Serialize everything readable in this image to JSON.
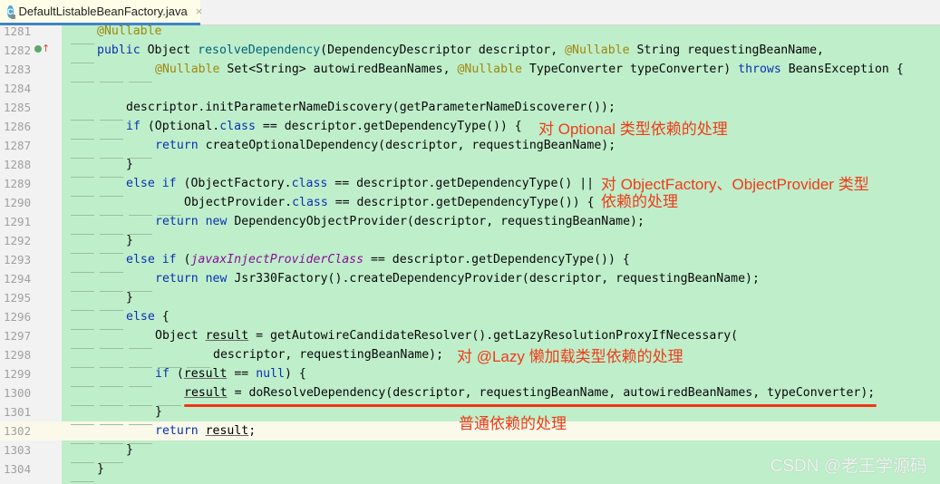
{
  "tab": {
    "icon": "java-class-icon",
    "icon_letter": "C",
    "filename": "DefaultListableBeanFactory.java",
    "close": "×"
  },
  "lines": [
    {
      "num": "1281",
      "indent": "——",
      "html": [
        [
          "ann",
          "@Nullable"
        ]
      ]
    },
    {
      "num": "1282",
      "indent": "——",
      "html": [
        [
          "kw",
          "public"
        ],
        [
          "code",
          " Object "
        ],
        [
          "fn",
          "resolveDependency"
        ],
        [
          "code",
          "(DependencyDescriptor descriptor, "
        ],
        [
          "ann",
          "@Nullable"
        ],
        [
          "code",
          " String requestingBeanName,"
        ]
      ]
    },
    {
      "num": "1283",
      "indent": "—— —— ——",
      "html": [
        [
          "ann",
          "@Nullable"
        ],
        [
          "code",
          " Set<String> autowiredBeanNames, "
        ],
        [
          "ann",
          "@Nullable"
        ],
        [
          "code",
          " TypeConverter typeConverter) "
        ],
        [
          "kw",
          "throws"
        ],
        [
          "code",
          " BeansException {"
        ]
      ]
    },
    {
      "num": "1284",
      "indent": "",
      "html": []
    },
    {
      "num": "1285",
      "indent": "—— ——",
      "html": [
        [
          "code",
          "descriptor.initParameterNameDiscovery(getParameterNameDiscoverer());"
        ]
      ]
    },
    {
      "num": "1286",
      "indent": "—— ——",
      "html": [
        [
          "kw",
          "if"
        ],
        [
          "code",
          " (Optional."
        ],
        [
          "kw",
          "class"
        ],
        [
          "code",
          " == descriptor.getDependencyType()) {"
        ]
      ]
    },
    {
      "num": "1287",
      "indent": "—— —— ——",
      "html": [
        [
          "kw",
          "return"
        ],
        [
          "code",
          " createOptionalDependency(descriptor, requestingBeanName);"
        ]
      ]
    },
    {
      "num": "1288",
      "indent": "—— ——",
      "html": [
        [
          "code",
          "}"
        ]
      ]
    },
    {
      "num": "1289",
      "indent": "—— ——",
      "html": [
        [
          "kw",
          "else if"
        ],
        [
          "code",
          " (ObjectFactory."
        ],
        [
          "kw",
          "class"
        ],
        [
          "code",
          " == descriptor.getDependencyType() ||"
        ]
      ]
    },
    {
      "num": "1290",
      "indent": "—— —— —— ——",
      "html": [
        [
          "code",
          "ObjectProvider."
        ],
        [
          "kw",
          "class"
        ],
        [
          "code",
          " == descriptor.getDependencyType()) {"
        ]
      ]
    },
    {
      "num": "1291",
      "indent": "—— —— ——",
      "html": [
        [
          "kw",
          "return new"
        ],
        [
          "code",
          " DependencyObjectProvider(descriptor, requestingBeanName);"
        ]
      ]
    },
    {
      "num": "1292",
      "indent": "—— ——",
      "html": [
        [
          "code",
          "}"
        ]
      ]
    },
    {
      "num": "1293",
      "indent": "—— ——",
      "html": [
        [
          "kw",
          "else if"
        ],
        [
          "code",
          " ("
        ],
        [
          "it",
          "javaxInjectProviderClass"
        ],
        [
          "code",
          " == descriptor.getDependencyType()) {"
        ]
      ]
    },
    {
      "num": "1294",
      "indent": "—— —— ——",
      "html": [
        [
          "kw",
          "return new"
        ],
        [
          "code",
          " Jsr330Factory().createDependencyProvider(descriptor, requestingBeanName);"
        ]
      ]
    },
    {
      "num": "1295",
      "indent": "—— ——",
      "html": [
        [
          "code",
          "}"
        ]
      ]
    },
    {
      "num": "1296",
      "indent": "—— ——",
      "html": [
        [
          "kw",
          "else"
        ],
        [
          "code",
          " {"
        ]
      ]
    },
    {
      "num": "1297",
      "indent": "—— —— ——",
      "html": [
        [
          "code",
          "Object "
        ],
        [
          "ul",
          "result"
        ],
        [
          "code",
          " = getAutowireCandidateResolver().getLazyResolutionProxyIfNecessary("
        ]
      ]
    },
    {
      "num": "1298",
      "indent": "—— —— —— —— ——",
      "html": [
        [
          "code",
          "descriptor, requestingBeanName);"
        ]
      ]
    },
    {
      "num": "1299",
      "indent": "—— —— ——",
      "html": [
        [
          "kw",
          "if"
        ],
        [
          "code",
          " ("
        ],
        [
          "ul",
          "result"
        ],
        [
          "code",
          " == "
        ],
        [
          "kw",
          "null"
        ],
        [
          "code",
          ") {"
        ]
      ]
    },
    {
      "num": "1300",
      "indent": "—— —— —— ——",
      "html": [
        [
          "ul",
          "result"
        ],
        [
          "code",
          " = doResolveDependency(descriptor, requestingBeanName, autowiredBeanNames, typeConverter);"
        ]
      ]
    },
    {
      "num": "1301",
      "indent": "—— —— ——",
      "html": [
        [
          "code",
          "}"
        ]
      ]
    },
    {
      "num": "1302",
      "indent": "—— —— ——",
      "html": [
        [
          "kw",
          "return"
        ],
        [
          "code",
          " "
        ],
        [
          "ul",
          "result"
        ],
        [
          "code",
          ";"
        ]
      ]
    },
    {
      "num": "1303",
      "indent": "—— ——",
      "html": [
        [
          "code",
          "}"
        ]
      ]
    },
    {
      "num": "1304",
      "indent": "——",
      "html": [
        [
          "code",
          "}"
        ]
      ]
    }
  ],
  "annotations": {
    "optional": "对 Optional 类型依赖的处理",
    "object_factory_1": "对 ObjectFactory、ObjectProvider 类型",
    "object_factory_2": "依赖的处理",
    "lazy": "对 @Lazy 懒加载类型依赖的处理",
    "normal": "普通依赖的处理"
  },
  "current_line": "1302",
  "colors": {
    "diff_bg": "#bfeecb",
    "annotation": "#f03b16",
    "keyword": "#0b32b0",
    "annotation_kw": "#9e880d"
  },
  "watermark": "CSDN @老王学源码"
}
